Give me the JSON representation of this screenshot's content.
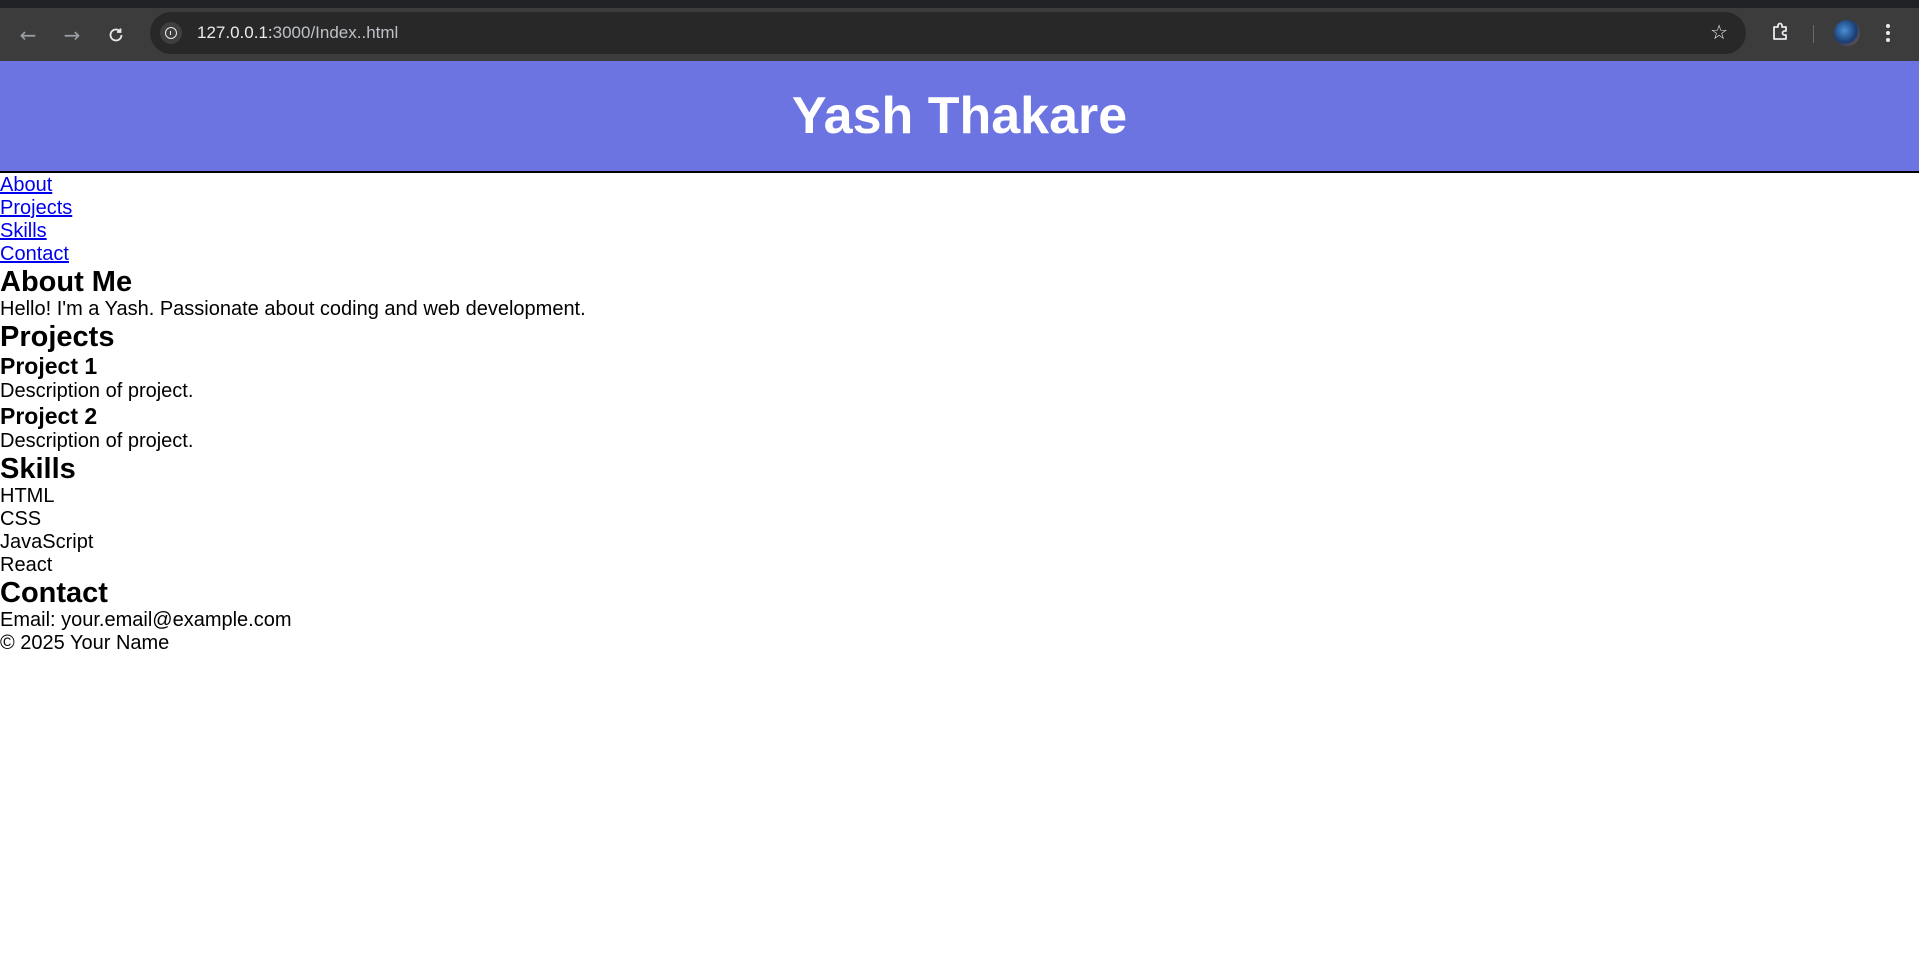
{
  "browser": {
    "url_host": "127.0.0.1:",
    "url_path": "3000/Index..html"
  },
  "header": {
    "title": "Yash Thakare",
    "background_color": "#6b74e0"
  },
  "nav": {
    "items": [
      {
        "label": "About"
      },
      {
        "label": "Projects"
      },
      {
        "label": "Skills"
      },
      {
        "label": "Contact"
      }
    ]
  },
  "about": {
    "heading": "About Me",
    "text": "Hello! I'm a Yash. Passionate about coding and web development."
  },
  "projects": {
    "heading": "Projects",
    "items": [
      {
        "title": "Project 1",
        "description": "Description of project."
      },
      {
        "title": "Project 2",
        "description": "Description of project."
      }
    ]
  },
  "skills": {
    "heading": "Skills",
    "items": [
      "HTML",
      "CSS",
      "JavaScript",
      "React"
    ]
  },
  "contact": {
    "heading": "Contact",
    "email_line": "Email: your.email@example.com"
  },
  "footer": {
    "text": "© 2025 Your Name"
  }
}
